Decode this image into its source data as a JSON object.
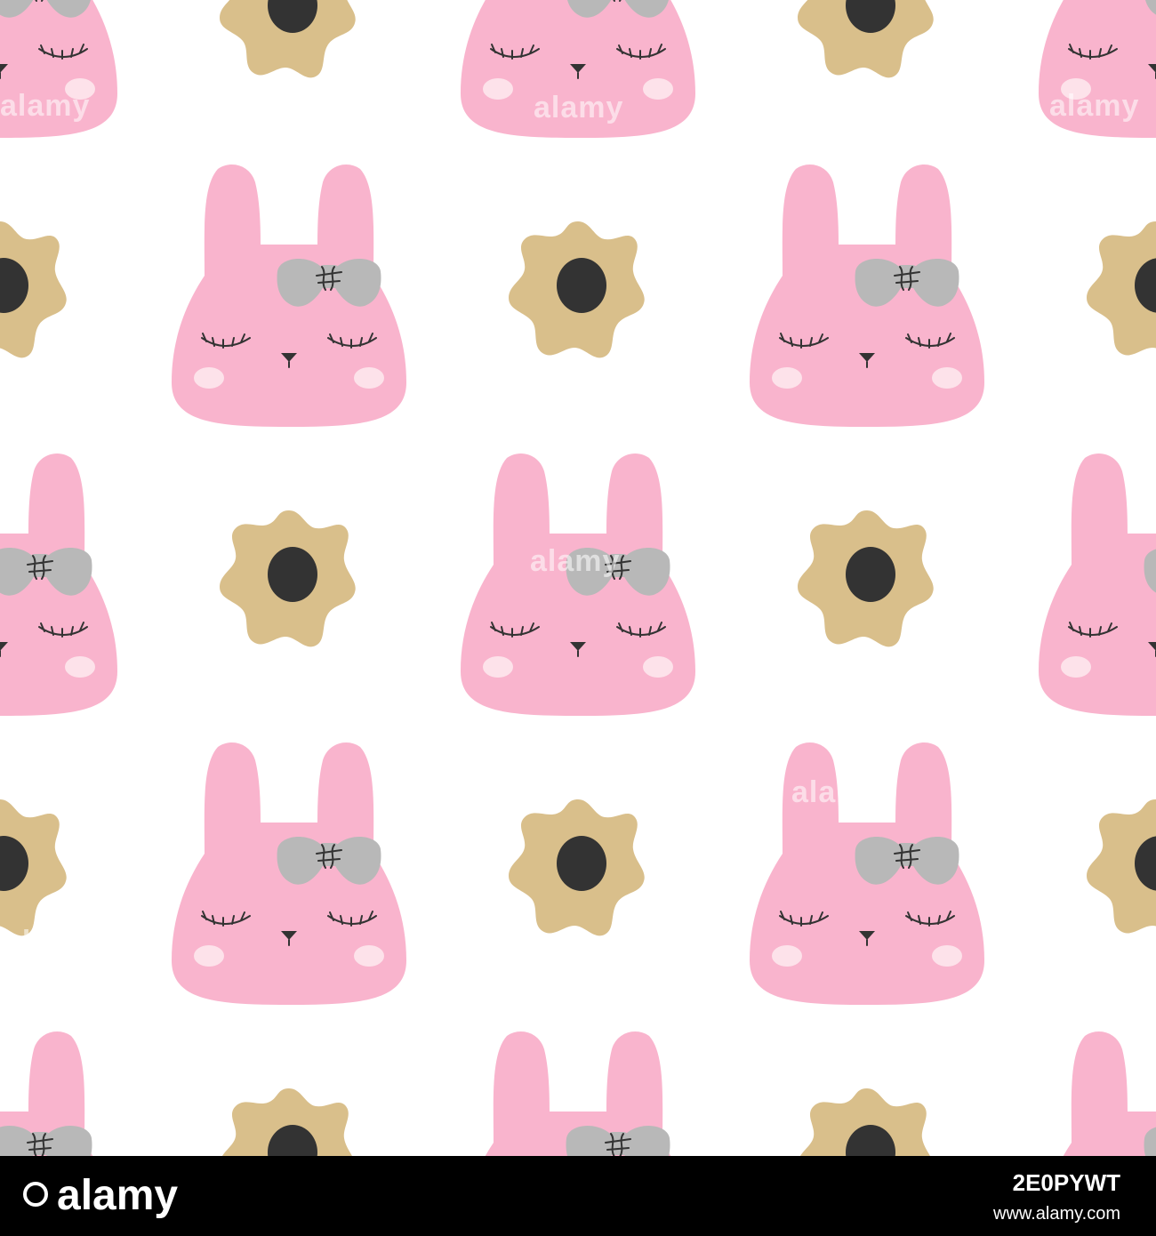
{
  "pattern": {
    "background_color": "#ffffff",
    "bunny_color": "#f9b4cd",
    "cheek_color": "#fde2ea",
    "bow_color": "#b8b8b8",
    "flower_color": "#d9bf8b",
    "flower_center_color": "#333333",
    "line_color": "#333333",
    "icons": [
      "bunny-face-icon",
      "bow-icon",
      "flower-icon"
    ]
  },
  "watermark": {
    "text": "alamy"
  },
  "footer": {
    "background_color": "#000000",
    "logo_text": "alamy",
    "image_id": "2E0PYWT",
    "url": "www.alamy.com"
  }
}
